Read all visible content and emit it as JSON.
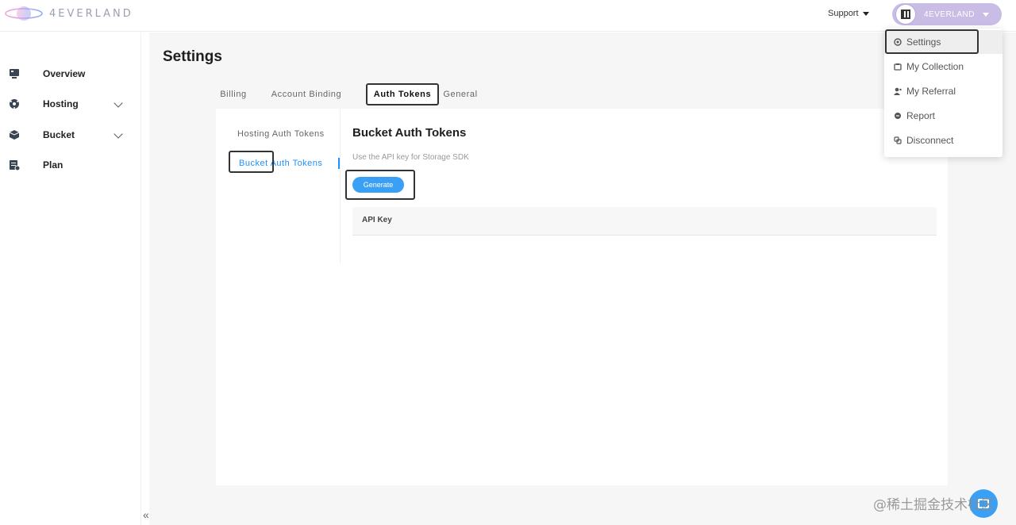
{
  "brand": {
    "name": "4EVERLAND"
  },
  "header": {
    "support_label": "Support",
    "account_name": "4EVERLAND"
  },
  "sidebar": {
    "items": [
      {
        "label": "Overview",
        "icon": "monitor-icon",
        "expandable": false
      },
      {
        "label": "Hosting",
        "icon": "hosting-icon",
        "expandable": true
      },
      {
        "label": "Bucket",
        "icon": "bucket-icon",
        "expandable": true
      },
      {
        "label": "Plan",
        "icon": "plan-icon",
        "expandable": false
      }
    ],
    "collapse_glyph": "«"
  },
  "main": {
    "title": "Settings",
    "tabs": [
      {
        "label": "Billing",
        "active": false
      },
      {
        "label": "Account Binding",
        "active": false
      },
      {
        "label": "Auth Tokens",
        "active": true
      },
      {
        "label": "General",
        "active": false
      }
    ],
    "subnav": [
      {
        "label": "Hosting Auth Tokens",
        "active": false
      },
      {
        "label": "Bucket Auth Tokens",
        "active": true
      }
    ],
    "section": {
      "title": "Bucket Auth Tokens",
      "description": "Use the API key for Storage SDK",
      "generate_label": "Generate",
      "table_headers": [
        "API Key"
      ]
    }
  },
  "dropdown": {
    "items": [
      {
        "label": "Settings",
        "icon": "gear-icon",
        "active": true
      },
      {
        "label": "My Collection",
        "icon": "collection-icon",
        "active": false
      },
      {
        "label": "My Referral",
        "icon": "referral-icon",
        "active": false
      },
      {
        "label": "Report",
        "icon": "report-icon",
        "active": false
      },
      {
        "label": "Disconnect",
        "icon": "disconnect-icon",
        "active": false
      }
    ]
  },
  "watermark": "@稀土掘金技术社区",
  "colors": {
    "accent": "#3aa0f5",
    "account_pill": "#c9bde6",
    "active_subnav": "#1e90ff"
  }
}
